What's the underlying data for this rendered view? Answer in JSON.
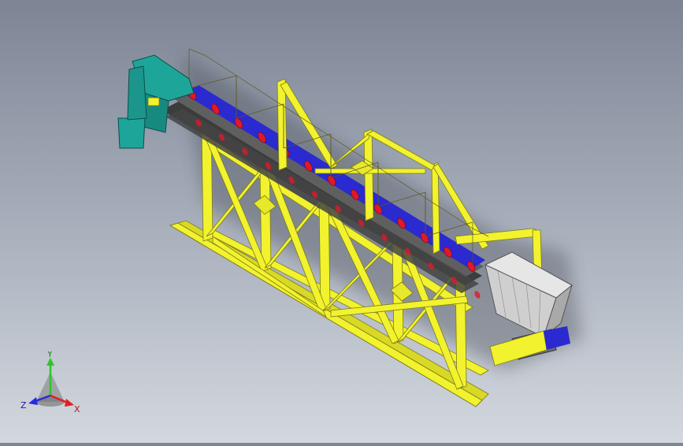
{
  "viewport": {
    "background_top": "#7d8595",
    "background_bottom": "#d3d8de"
  },
  "model": {
    "frame_color": "#f2f22e",
    "frame_outline": "#7c7c1a",
    "belt_color": "#2a2ad0",
    "roller_color": "#e0182c",
    "head_chute_color": "#1ea59a",
    "hopper_color": "#d7d7d7",
    "trough_color": "#5a5a5a"
  },
  "triad": {
    "x_label": "X",
    "y_label": "Y",
    "z_label": "Z",
    "x_color": "#e02020",
    "y_color": "#2ec42e",
    "z_color": "#2a2ae0"
  }
}
